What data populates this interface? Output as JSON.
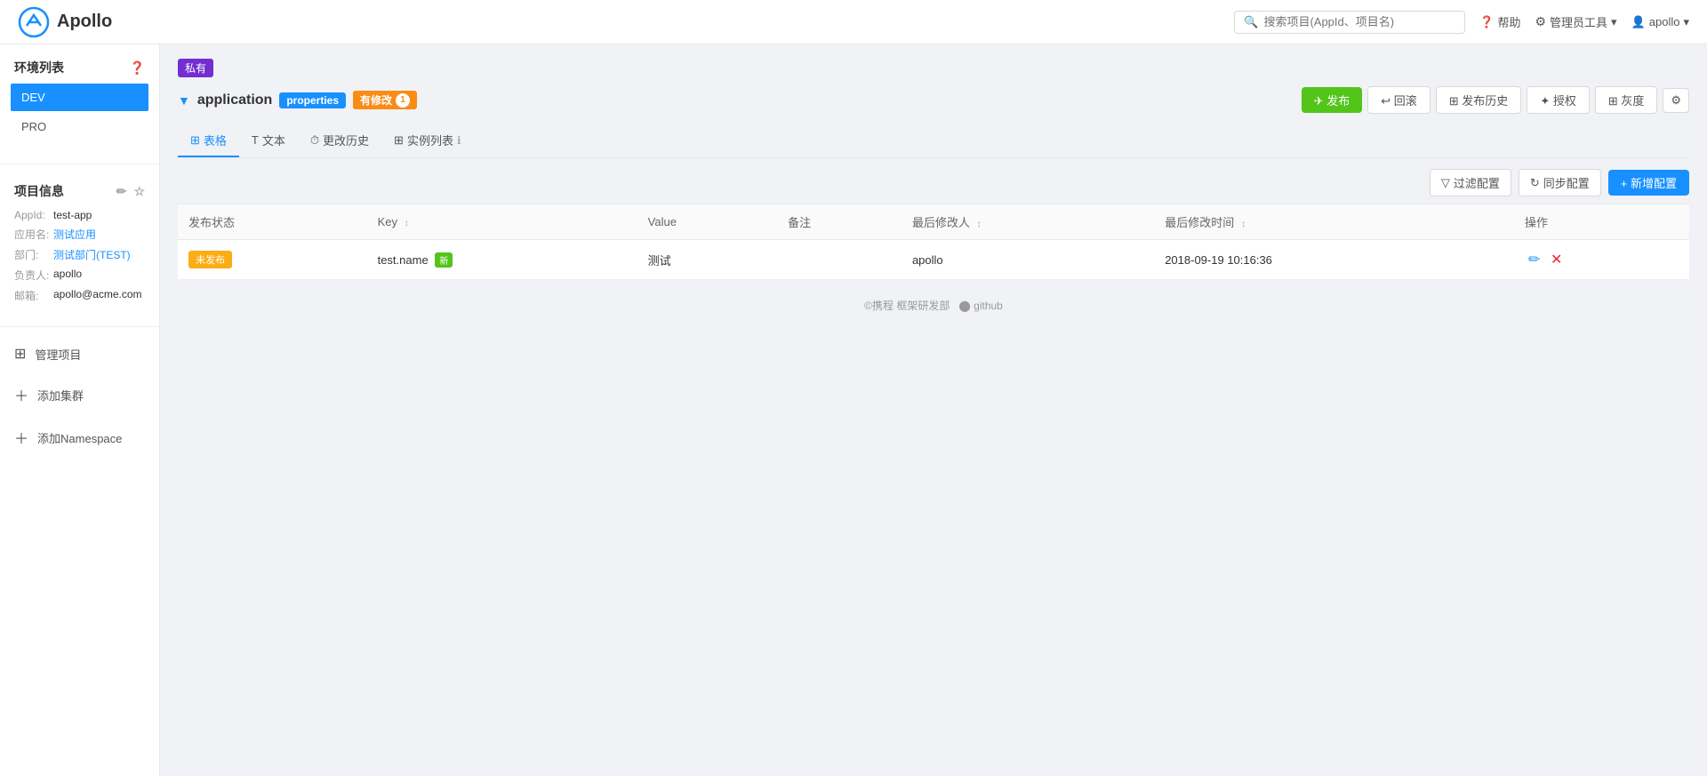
{
  "navbar": {
    "brand": "Apollo",
    "search_placeholder": "搜索项目(AppId、项目名)",
    "help_label": "帮助",
    "admin_label": "管理员工具",
    "user_label": "apollo"
  },
  "sidebar": {
    "env_section_title": "环境列表",
    "envs": [
      {
        "label": "DEV",
        "active": true
      },
      {
        "label": "PRO",
        "active": false
      }
    ],
    "project_section_title": "项目信息",
    "project": {
      "appid_label": "AppId:",
      "appid_value": "test-app",
      "appname_label": "应用名:",
      "appname_value": "测试应用",
      "dept_label": "部门:",
      "dept_value": "测试部门(TEST)",
      "owner_label": "负责人:",
      "owner_value": "apollo",
      "email_label": "邮箱:",
      "email_value": "apollo@acme.com"
    },
    "manage_label": "管理项目",
    "add_cluster_label": "添加集群",
    "add_namespace_label": "添加Namespace"
  },
  "main": {
    "badge_private": "私有",
    "namespace_name": "application",
    "tag_properties": "properties",
    "tag_modified": "有修改",
    "tag_modified_count": "1",
    "buttons": {
      "publish": "✈ 发布",
      "rollback": "↩ 回滚",
      "publish_history": "⊞ 发布历史",
      "authorize": "✦ 授权",
      "grey": "⊞ 灰度",
      "settings": "⚙"
    },
    "tabs": [
      {
        "label": "⊞ 表格",
        "icon": "table",
        "active": true
      },
      {
        "label": "T 文本",
        "icon": "text",
        "active": false
      },
      {
        "label": "⏱ 更改历史",
        "icon": "history",
        "active": false
      },
      {
        "label": "⊞ 实例列表",
        "icon": "instance",
        "active": false,
        "info_icon": true
      }
    ],
    "toolbar": {
      "filter_label": "过滤配置",
      "sync_label": "同步配置",
      "add_label": "+ 新增配置"
    },
    "table": {
      "columns": [
        "发布状态",
        "Key",
        "Value",
        "备注",
        "最后修改人",
        "最后修改时间",
        "操作"
      ],
      "rows": [
        {
          "status": "未发布",
          "key": "test.name",
          "key_new": true,
          "value": "测试",
          "remark": "",
          "modifier": "apollo",
          "modified_time": "2018-09-19 10:16:36"
        }
      ]
    }
  },
  "footer": {
    "copyright": "©携程 框架研发部",
    "github_label": "github"
  }
}
